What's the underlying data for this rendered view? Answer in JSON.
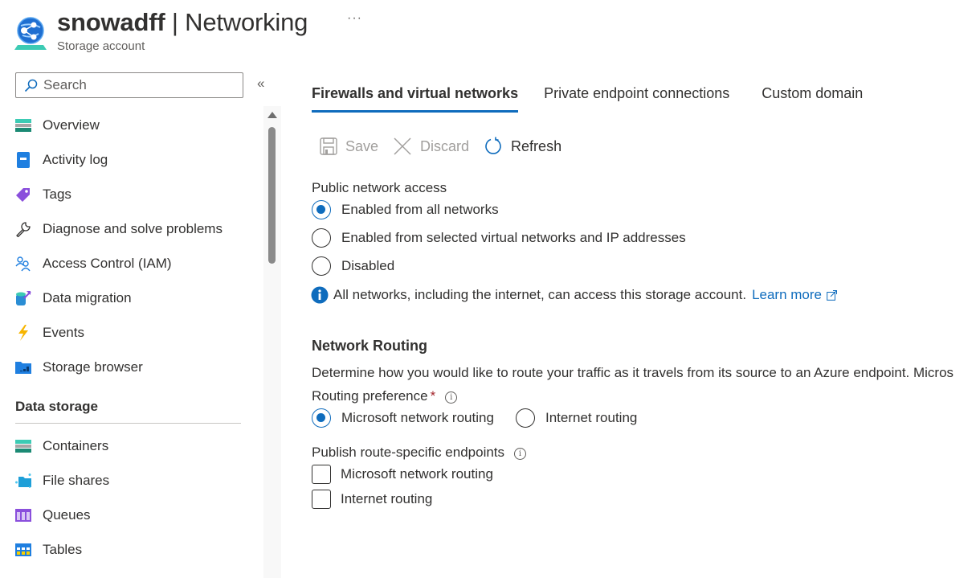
{
  "header": {
    "resource_name": "snowadff",
    "separator": " | ",
    "page_title": "Networking",
    "subtitle": "Storage account",
    "more_label": "···",
    "icon": "storage-account-globe-icon"
  },
  "sidebar": {
    "search": {
      "placeholder": "Search",
      "value": "",
      "icon": "search-icon"
    },
    "collapse_label": "«",
    "items": [
      {
        "label": "Overview",
        "icon": "overview-icon"
      },
      {
        "label": "Activity log",
        "icon": "activity-log-icon"
      },
      {
        "label": "Tags",
        "icon": "tag-icon"
      },
      {
        "label": "Diagnose and solve problems",
        "icon": "wrench-icon"
      },
      {
        "label": "Access Control (IAM)",
        "icon": "people-icon"
      },
      {
        "label": "Data migration",
        "icon": "data-migration-icon"
      },
      {
        "label": "Events",
        "icon": "lightning-icon"
      },
      {
        "label": "Storage browser",
        "icon": "storage-browser-icon"
      }
    ],
    "sections": [
      {
        "title": "Data storage",
        "items": [
          {
            "label": "Containers",
            "icon": "containers-icon"
          },
          {
            "label": "File shares",
            "icon": "file-shares-icon"
          },
          {
            "label": "Queues",
            "icon": "queues-icon"
          },
          {
            "label": "Tables",
            "icon": "tables-icon"
          }
        ]
      }
    ]
  },
  "main": {
    "tabs": [
      {
        "label": "Firewalls and virtual networks",
        "active": true
      },
      {
        "label": "Private endpoint connections",
        "active": false
      },
      {
        "label": "Custom domain",
        "active": false
      }
    ],
    "toolbar": {
      "save_label": "Save",
      "discard_label": "Discard",
      "refresh_label": "Refresh"
    },
    "public_network_access": {
      "label": "Public network access",
      "options": [
        {
          "label": "Enabled from all networks",
          "selected": true
        },
        {
          "label": "Enabled from selected virtual networks and IP addresses",
          "selected": false
        },
        {
          "label": "Disabled",
          "selected": false
        }
      ],
      "info_text": "All networks, including the internet, can access this storage account.",
      "learn_more": "Learn more"
    },
    "network_routing": {
      "title": "Network Routing",
      "description": "Determine how you would like to route your traffic as it travels from its source to an Azure endpoint. Micros",
      "routing_preference_label": "Routing preference",
      "required_mark": "*",
      "routing_options": [
        {
          "label": "Microsoft network routing",
          "selected": true
        },
        {
          "label": "Internet routing",
          "selected": false
        }
      ],
      "publish_label": "Publish route-specific endpoints",
      "publish_options": [
        {
          "label": "Microsoft network routing",
          "checked": false
        },
        {
          "label": "Internet routing",
          "checked": false
        }
      ]
    }
  },
  "colors": {
    "accent": "#0f6cbd",
    "text": "#323130",
    "muted": "#605e5c",
    "disabled": "#a19f9d",
    "required": "#a4262c"
  }
}
